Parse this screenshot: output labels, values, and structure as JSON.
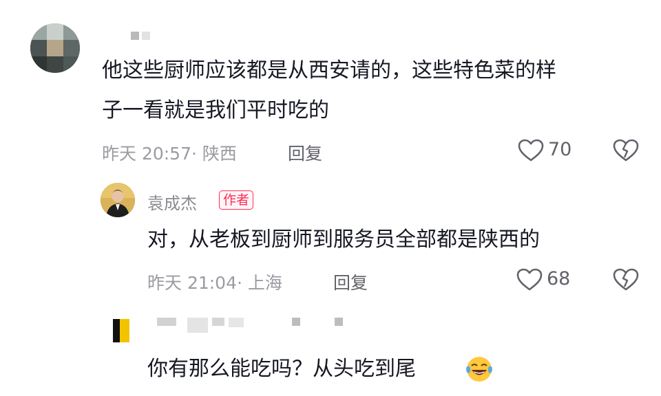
{
  "comments": [
    {
      "text_line1": "他这些厨师应该都是从西安请的，这些特色菜的样",
      "text_line2": "子一看就是我们平时吃的",
      "time": "昨天 20:57",
      "location": "· 陕西",
      "reply_label": "回复",
      "likes": "70"
    },
    {
      "name": "袁成杰",
      "badge": "作者",
      "text": "对，从老板到厨师到服务员全部都是陕西的",
      "time": "昨天 21:04",
      "location": "· 上海",
      "reply_label": "回复",
      "likes": "68"
    },
    {
      "text": "你有那么能吃吗？从头吃到尾",
      "emoji": "😂"
    }
  ],
  "icons": {
    "like": "heart-outline-icon",
    "dislike": "broken-heart-icon"
  },
  "colors": {
    "author_badge": "#fe2c55",
    "meta_text": "#9a9ba1",
    "body_text": "#161823"
  }
}
